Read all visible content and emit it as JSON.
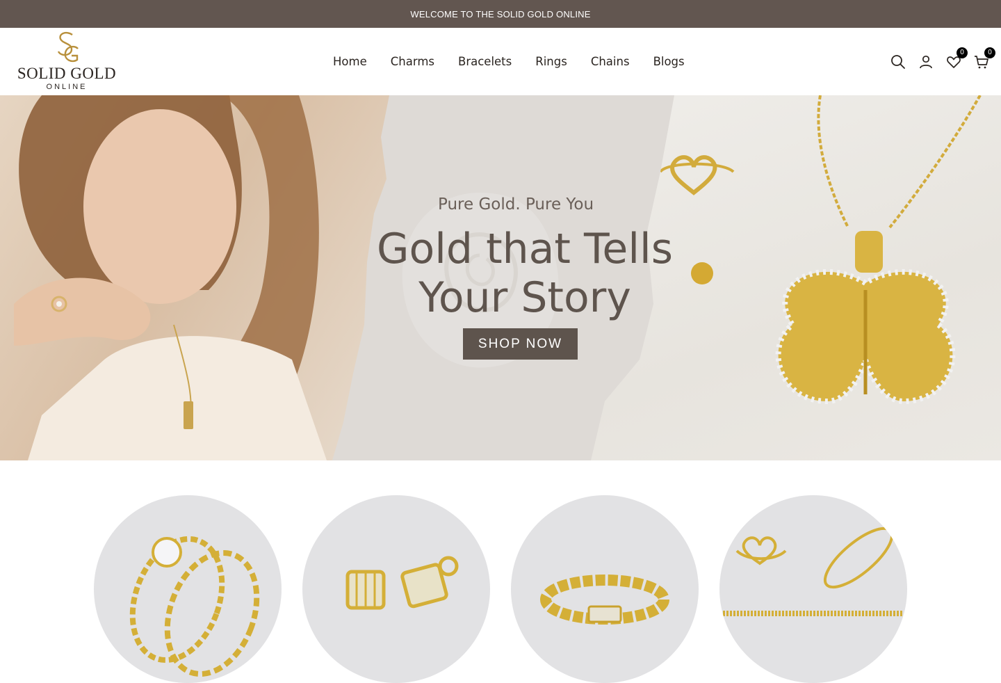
{
  "announcement": "WELCOME TO THE SOLID GOLD ONLINE",
  "brand": {
    "name_line1": "SOLID GOLD",
    "name_line2": "ONLINE",
    "gold_color": "#b8903c",
    "dark_color": "#5e544d"
  },
  "nav": {
    "items": [
      "Home",
      "Charms",
      "Bracelets",
      "Rings",
      "Chains",
      "Blogs"
    ]
  },
  "header_icons": {
    "search": "search-icon",
    "account": "user-icon",
    "wishlist": "heart-icon",
    "wishlist_count": "0",
    "cart": "shopping-bag-icon",
    "cart_count": "0"
  },
  "hero": {
    "subtitle": "Pure Gold. Pure You",
    "title_line1": "Gold that Tells",
    "title_line2": "Your Story",
    "cta": "SHOP NOW"
  },
  "categories": [
    {
      "image": "rings"
    },
    {
      "image": "earrings"
    },
    {
      "image": "bracelets"
    },
    {
      "image": "mixed-jewelry"
    }
  ]
}
